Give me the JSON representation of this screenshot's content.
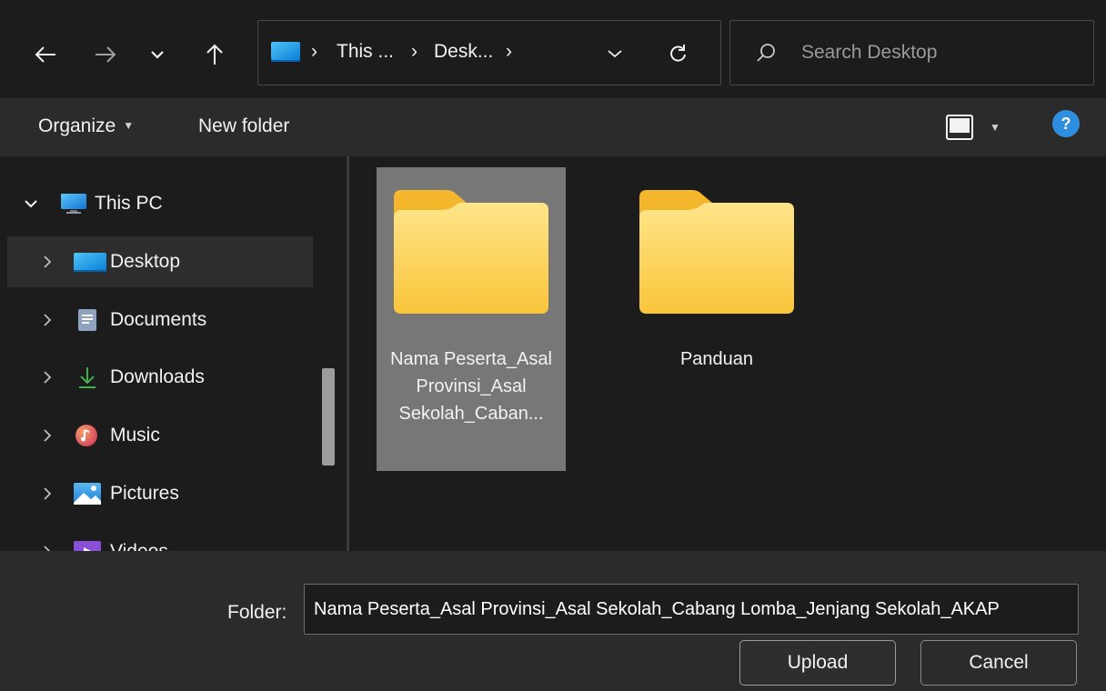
{
  "address": {
    "crumbs": [
      "This ...",
      "Desk..."
    ],
    "separator": "›"
  },
  "search": {
    "placeholder": "Search Desktop"
  },
  "commandbar": {
    "organize_label": "Organize",
    "new_folder_label": "New folder",
    "help_label": "?"
  },
  "nav": {
    "items": [
      {
        "label": "This PC",
        "icon": "monitor-icon",
        "expanded": true
      },
      {
        "label": "Desktop",
        "icon": "desktop-icon",
        "selected": true
      },
      {
        "label": "Documents",
        "icon": "documents-icon"
      },
      {
        "label": "Downloads",
        "icon": "download-icon"
      },
      {
        "label": "Music",
        "icon": "music-icon"
      },
      {
        "label": "Pictures",
        "icon": "pictures-icon"
      },
      {
        "label": "Videos",
        "icon": "videos-icon"
      }
    ]
  },
  "content": {
    "folders": [
      {
        "name": "Nama Peserta_Asal Provinsi_Asal Sekolah_Caban...",
        "selected": true
      },
      {
        "name": "Panduan",
        "selected": false
      }
    ]
  },
  "footer": {
    "folder_label": "Folder:",
    "folder_value": "Nama Peserta_Asal Provinsi_Asal Sekolah_Cabang Lomba_Jenjang Sekolah_AKAP",
    "upload_label": "Upload",
    "cancel_label": "Cancel"
  },
  "colors": {
    "accent": "#2e8fe0",
    "folder": "#f7c948",
    "selection": "#777777"
  }
}
